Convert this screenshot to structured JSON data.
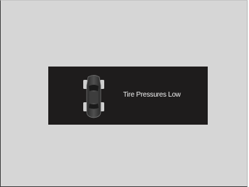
{
  "screen": {
    "message": "Tire Pressures Low",
    "icon": "car-top-view-tire-icon",
    "colors": {
      "background": "#d6d6d6",
      "display_panel": "#1e1c1c",
      "text": "#f2f2f2"
    }
  }
}
